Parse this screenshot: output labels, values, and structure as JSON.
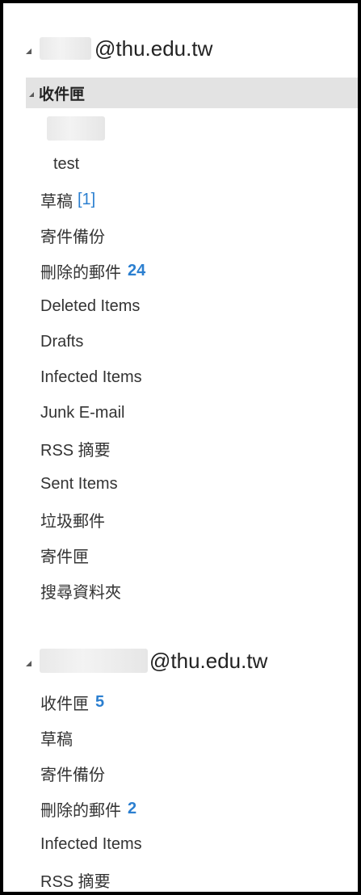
{
  "account1": {
    "email_suffix": "@thu.edu.tw",
    "inbox": {
      "label": "收件匣",
      "subfolders": [
        {
          "label": ""
        },
        {
          "label": "test"
        }
      ]
    },
    "folders": [
      {
        "label": "草稿",
        "draft_count": "[1]"
      },
      {
        "label": "寄件備份"
      },
      {
        "label": "刪除的郵件",
        "unread": "24"
      },
      {
        "label": "Deleted Items"
      },
      {
        "label": "Drafts"
      },
      {
        "label": "Infected Items"
      },
      {
        "label": "Junk E-mail"
      },
      {
        "label": "RSS 摘要"
      },
      {
        "label": "Sent Items"
      },
      {
        "label": "垃圾郵件"
      },
      {
        "label": "寄件匣"
      },
      {
        "label": "搜尋資料夾"
      }
    ]
  },
  "account2": {
    "email_suffix": "@thu.edu.tw",
    "folders": [
      {
        "label": "收件匣",
        "unread": "5"
      },
      {
        "label": "草稿"
      },
      {
        "label": "寄件備份"
      },
      {
        "label": "刪除的郵件",
        "unread": "2"
      },
      {
        "label": "Infected Items"
      },
      {
        "label": "RSS 摘要"
      }
    ]
  },
  "colors": {
    "unread": "#2b7fd0",
    "selected_bg": "#e3e3e3",
    "frame": "#000000"
  }
}
